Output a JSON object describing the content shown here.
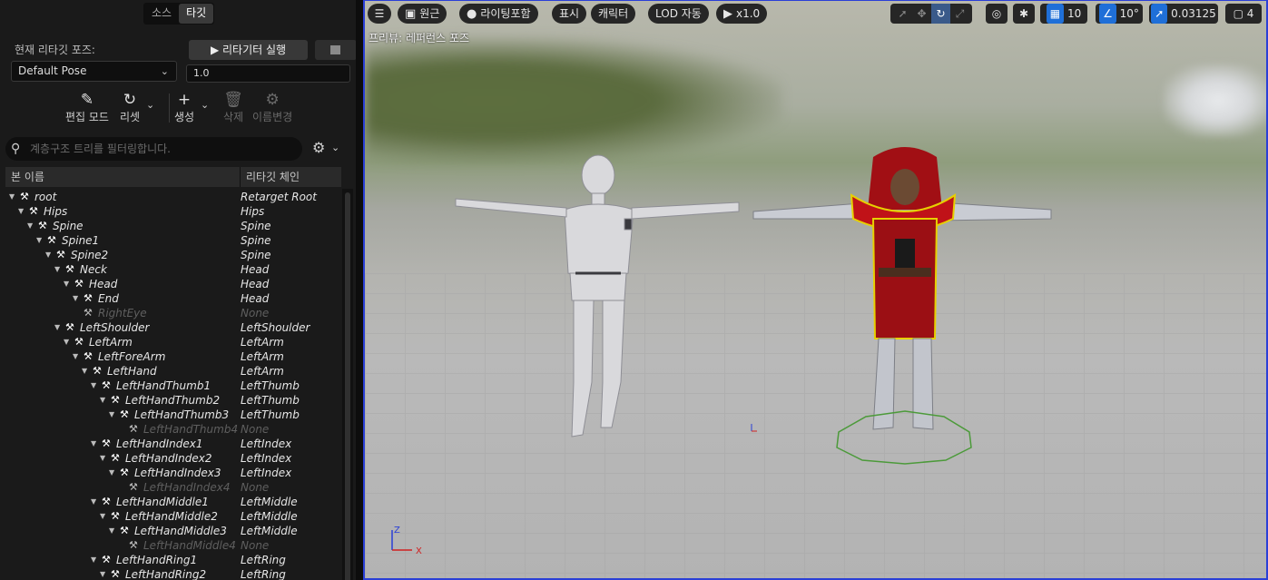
{
  "left": {
    "tabs": [
      {
        "label": "소스",
        "active": false
      },
      {
        "label": "타깃",
        "active": true
      }
    ],
    "current_pose_label": "현재 리타깃 포즈:",
    "pose_value": "Default Pose",
    "run_retargeter": "리타기터 실행",
    "blend_value": "1.0",
    "toolbar": {
      "edit_mode": "편집 모드",
      "reset": "리셋",
      "create": "생성",
      "delete": "삭제",
      "rename": "이름변경"
    },
    "search_placeholder": "계층구조 트리를 필터링합니다.",
    "columns": {
      "bone": "본 이름",
      "chain": "리타깃 체인"
    },
    "bones": [
      {
        "name": "root",
        "chain": "Retarget Root",
        "depth": 0,
        "dim": false
      },
      {
        "name": "Hips",
        "chain": "Hips",
        "depth": 1,
        "dim": false
      },
      {
        "name": "Spine",
        "chain": "Spine",
        "depth": 2,
        "dim": false
      },
      {
        "name": "Spine1",
        "chain": "Spine",
        "depth": 3,
        "dim": false
      },
      {
        "name": "Spine2",
        "chain": "Spine",
        "depth": 4,
        "dim": false
      },
      {
        "name": "Neck",
        "chain": "Head",
        "depth": 5,
        "dim": false
      },
      {
        "name": "Head",
        "chain": "Head",
        "depth": 6,
        "dim": false
      },
      {
        "name": "End",
        "chain": "Head",
        "depth": 7,
        "dim": false
      },
      {
        "name": "RightEye",
        "chain": "None",
        "depth": 7,
        "dim": true
      },
      {
        "name": "LeftShoulder",
        "chain": "LeftShoulder",
        "depth": 5,
        "dim": false
      },
      {
        "name": "LeftArm",
        "chain": "LeftArm",
        "depth": 6,
        "dim": false
      },
      {
        "name": "LeftForeArm",
        "chain": "LeftArm",
        "depth": 7,
        "dim": false
      },
      {
        "name": "LeftHand",
        "chain": "LeftArm",
        "depth": 8,
        "dim": false
      },
      {
        "name": "LeftHandThumb1",
        "chain": "LeftThumb",
        "depth": 9,
        "dim": false
      },
      {
        "name": "LeftHandThumb2",
        "chain": "LeftThumb",
        "depth": 10,
        "dim": false
      },
      {
        "name": "LeftHandThumb3",
        "chain": "LeftThumb",
        "depth": 11,
        "dim": false
      },
      {
        "name": "LeftHandThumb4",
        "chain": "None",
        "depth": 12,
        "dim": true
      },
      {
        "name": "LeftHandIndex1",
        "chain": "LeftIndex",
        "depth": 9,
        "dim": false
      },
      {
        "name": "LeftHandIndex2",
        "chain": "LeftIndex",
        "depth": 10,
        "dim": false
      },
      {
        "name": "LeftHandIndex3",
        "chain": "LeftIndex",
        "depth": 11,
        "dim": false
      },
      {
        "name": "LeftHandIndex4",
        "chain": "None",
        "depth": 12,
        "dim": true
      },
      {
        "name": "LeftHandMiddle1",
        "chain": "LeftMiddle",
        "depth": 9,
        "dim": false
      },
      {
        "name": "LeftHandMiddle2",
        "chain": "LeftMiddle",
        "depth": 10,
        "dim": false
      },
      {
        "name": "LeftHandMiddle3",
        "chain": "LeftMiddle",
        "depth": 11,
        "dim": false
      },
      {
        "name": "LeftHandMiddle4",
        "chain": "None",
        "depth": 12,
        "dim": true
      },
      {
        "name": "LeftHandRing1",
        "chain": "LeftRing",
        "depth": 9,
        "dim": false
      },
      {
        "name": "LeftHandRing2",
        "chain": "LeftRing",
        "depth": 10,
        "dim": false
      }
    ]
  },
  "viewport": {
    "toolbar": {
      "perspective": "원근",
      "lighting": "라이팅포함",
      "show": "표시",
      "character": "캐릭터",
      "lod": "LOD 자동",
      "speed": "x1.0",
      "grid_snap": "10",
      "rotation_snap": "10°",
      "scale_snap": "0.03125",
      "camera_speed": "4"
    },
    "preview_label": "프리뷰: 레퍼런스 포즈",
    "axis": {
      "x": "X",
      "z": "Z"
    }
  },
  "colors": {
    "accent": "#1f6fd8",
    "viewport_border": "#2a3fd6"
  }
}
